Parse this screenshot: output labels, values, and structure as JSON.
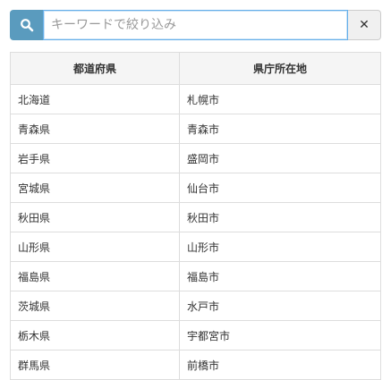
{
  "search": {
    "placeholder": "キーワードで絞り込み",
    "icon": "search-icon",
    "clear_icon": "close-icon",
    "clear_label": "✕"
  },
  "table": {
    "headers": [
      "都道府県",
      "県庁所在地"
    ],
    "rows": [
      [
        "北海道",
        "札幌市"
      ],
      [
        "青森県",
        "青森市"
      ],
      [
        "岩手県",
        "盛岡市"
      ],
      [
        "宮城県",
        "仙台市"
      ],
      [
        "秋田県",
        "秋田市"
      ],
      [
        "山形県",
        "山形市"
      ],
      [
        "福島県",
        "福島市"
      ],
      [
        "茨城県",
        "水戸市"
      ],
      [
        "栃木県",
        "宇都宮市"
      ],
      [
        "群馬県",
        "前橋市"
      ]
    ]
  },
  "colors": {
    "search_button": "#5a9bbe",
    "input_focus_border": "#66afe9",
    "header_bg": "#f5f5f5",
    "border": "#dddddd"
  }
}
